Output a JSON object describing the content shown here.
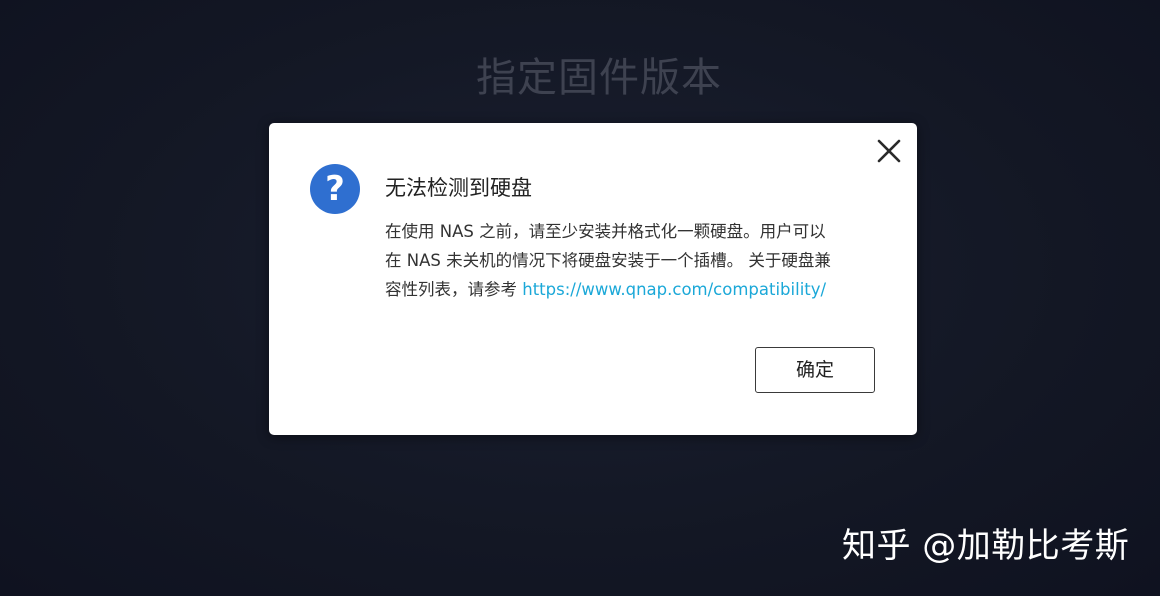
{
  "background": {
    "title": "指定固件版本"
  },
  "dialog": {
    "title": "无法检测到硬盘",
    "body_line1": "在使用 NAS 之前，请至少安装并格式化一颗硬盘。用户可以",
    "body_line2": "在 NAS 未关机的情况下将硬盘安装于一个插槽。 关于硬盘兼",
    "body_line3": "容性列表，请参考 ",
    "link": "https://www.qnap.com/compatibility/",
    "ok_label": "确定",
    "icon": "question-icon",
    "close_icon": "close-icon"
  },
  "watermark": "知乎 @加勒比考斯",
  "colors": {
    "background": "#141826",
    "dialog": "#ffffff",
    "icon_blue": "#2f6fd0",
    "link": "#1ba8d8"
  }
}
